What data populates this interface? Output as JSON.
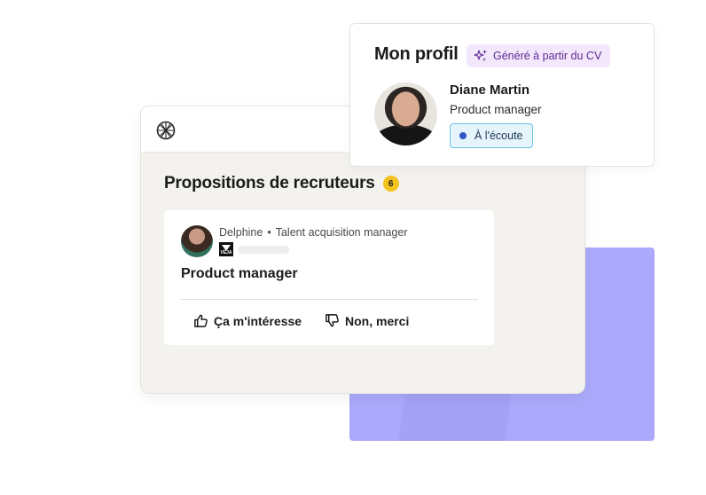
{
  "propositions": {
    "title": "Propositions de recruteurs",
    "count": "6",
    "offer": {
      "recruiter_name": "Delphine",
      "separator": "•",
      "recruiter_role": "Talent acquisition manager",
      "company_logo_text": "VEJA",
      "job_title": "Product manager",
      "like_label": "Ça m'intéresse",
      "dislike_label": "Non, merci"
    }
  },
  "profile": {
    "title": "Mon profil",
    "cv_badge": "Généré à partir du CV",
    "name": "Diane Martin",
    "role": "Product manager",
    "status": "À l'écoute"
  },
  "colors": {
    "accent_purple": "#aaa9fb",
    "count_badge": "#f5c31f",
    "status_dot": "#3157c8",
    "cv_badge_bg": "#f3e8fb"
  },
  "icons": [
    "logo-icon",
    "sparkles-icon",
    "thumbs-up-icon",
    "thumbs-down-icon"
  ]
}
